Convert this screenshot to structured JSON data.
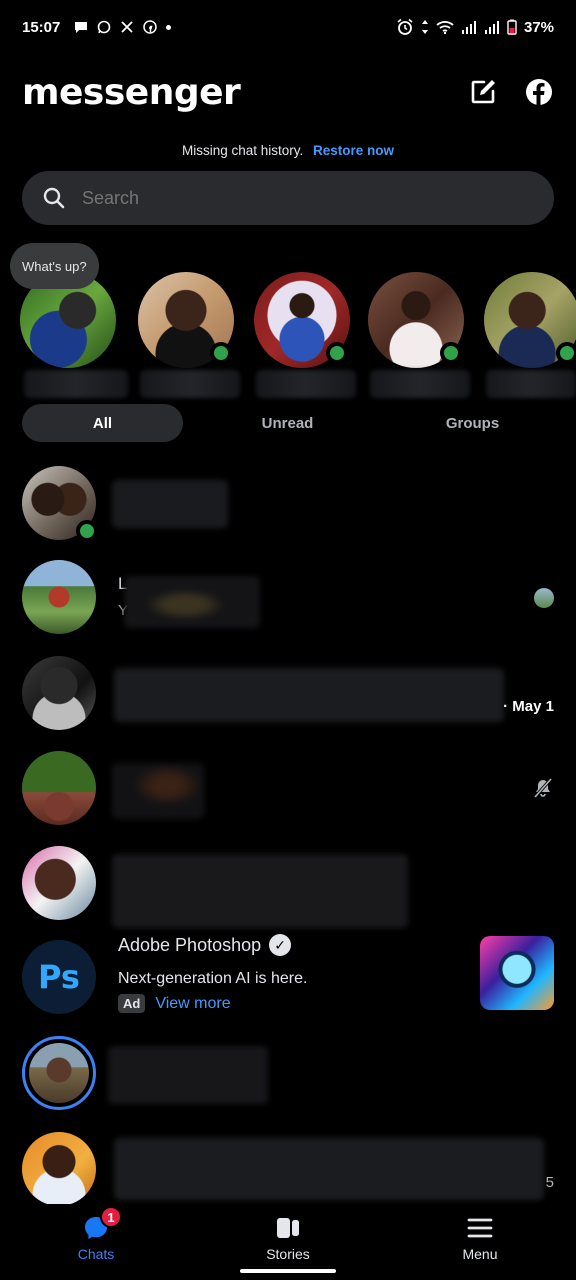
{
  "status_bar": {
    "time": "15:07",
    "battery": "37%",
    "icons_left": [
      "message-icon",
      "whatsapp-icon",
      "tools-icon",
      "facebook-icon"
    ],
    "icons_right": [
      "alarm-icon",
      "data-arrows-icon",
      "wifi-icon",
      "signal-icon",
      "signal-icon",
      "battery-icon"
    ]
  },
  "header": {
    "title": "messenger",
    "compose_icon": "compose-icon",
    "facebook_icon": "facebook-icon"
  },
  "notice": {
    "text": "Missing chat history.",
    "link": "Restore now"
  },
  "search": {
    "placeholder": "Search"
  },
  "stories": {
    "note_bubble": "What's up?",
    "items": [
      {
        "online": false,
        "color": "#3f6b2a"
      },
      {
        "online": true,
        "color": "#9b6a4a"
      },
      {
        "online": true,
        "color": "#8a2a2a"
      },
      {
        "online": true,
        "color": "#5a3a30"
      },
      {
        "online": true,
        "color": "#6b5a3a"
      }
    ]
  },
  "filters": {
    "tabs": [
      "All",
      "Unread",
      "Groups"
    ],
    "active": "All"
  },
  "chats": [
    {
      "online": true,
      "meta": "",
      "meta_icon": ""
    },
    {
      "online": false,
      "name_initial": "L",
      "preview_initial": "Y",
      "meta": "",
      "meta_icon": "seen-avatar-icon"
    },
    {
      "online": false,
      "meta": "· May 1",
      "meta_icon": ""
    },
    {
      "online": false,
      "meta": "",
      "meta_icon": "muted-bell-icon"
    },
    {
      "online": false,
      "meta": "",
      "meta_icon": ""
    },
    {
      "type": "ad",
      "title": "Adobe Photoshop",
      "logo_text": "Ps",
      "subtitle": "Next-generation AI is here.",
      "ad_label": "Ad",
      "link": "View more"
    },
    {
      "online": false,
      "story_ring": true,
      "meta": "",
      "meta_icon": ""
    },
    {
      "online": false,
      "meta": "5",
      "meta_icon": ""
    }
  ],
  "bottom_nav": {
    "items": [
      {
        "label": "Chats",
        "icon": "chat-bubble-icon",
        "badge": "1",
        "active": true
      },
      {
        "label": "Stories",
        "icon": "stories-icon",
        "active": false
      },
      {
        "label": "Menu",
        "icon": "menu-icon",
        "active": false
      }
    ]
  },
  "colors": {
    "accent": "#4599ff",
    "online": "#31a24c",
    "badge": "#e41e3f",
    "surface": "#2a2b2e"
  }
}
